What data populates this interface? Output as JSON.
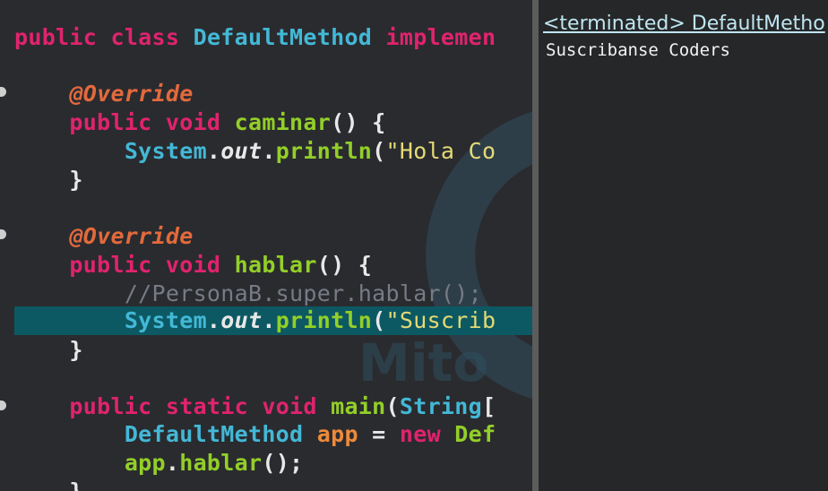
{
  "editor": {
    "lines": [
      {
        "tokens": [
          {
            "t": "public",
            "c": "kw"
          },
          {
            "t": " ",
            "c": "wh"
          },
          {
            "t": "class",
            "c": "kw"
          },
          {
            "t": " ",
            "c": "wh"
          },
          {
            "t": "DefaultMethod",
            "c": "ty"
          },
          {
            "t": " ",
            "c": "wh"
          },
          {
            "t": "implemen",
            "c": "kw"
          }
        ]
      },
      {
        "tokens": [
          {
            "t": "    ",
            "c": "wh"
          },
          {
            "t": "@Override",
            "c": "ann"
          }
        ]
      },
      {
        "tokens": [
          {
            "t": "    ",
            "c": "wh"
          },
          {
            "t": "public",
            "c": "kw"
          },
          {
            "t": " ",
            "c": "wh"
          },
          {
            "t": "void",
            "c": "kw"
          },
          {
            "t": " ",
            "c": "wh"
          },
          {
            "t": "caminar",
            "c": "fn"
          },
          {
            "t": "() {",
            "c": "wh"
          }
        ]
      },
      {
        "tokens": [
          {
            "t": "        ",
            "c": "wh"
          },
          {
            "t": "System",
            "c": "ty"
          },
          {
            "t": ".",
            "c": "wh"
          },
          {
            "t": "out",
            "c": "it"
          },
          {
            "t": ".",
            "c": "wh"
          },
          {
            "t": "println",
            "c": "fn"
          },
          {
            "t": "(",
            "c": "wh"
          },
          {
            "t": "\"Hola Co",
            "c": "st"
          }
        ]
      },
      {
        "tokens": [
          {
            "t": "    }",
            "c": "wh"
          }
        ]
      },
      {
        "tokens": [
          {
            "t": "    ",
            "c": "wh"
          },
          {
            "t": "@Override",
            "c": "ann"
          }
        ]
      },
      {
        "tokens": [
          {
            "t": "    ",
            "c": "wh"
          },
          {
            "t": "public",
            "c": "kw"
          },
          {
            "t": " ",
            "c": "wh"
          },
          {
            "t": "void",
            "c": "kw"
          },
          {
            "t": " ",
            "c": "wh"
          },
          {
            "t": "hablar",
            "c": "fn"
          },
          {
            "t": "() {",
            "c": "wh"
          }
        ]
      },
      {
        "tokens": [
          {
            "t": "        ",
            "c": "wh"
          },
          {
            "t": "//PersonaB.super.hablar();",
            "c": "cm"
          }
        ]
      },
      {
        "tokens": [
          {
            "t": "        ",
            "c": "wh"
          },
          {
            "t": "System",
            "c": "ty"
          },
          {
            "t": ".",
            "c": "wh"
          },
          {
            "t": "out",
            "c": "it"
          },
          {
            "t": ".",
            "c": "wh"
          },
          {
            "t": "println",
            "c": "fn"
          },
          {
            "t": "(",
            "c": "wh"
          },
          {
            "t": "\"Suscrib",
            "c": "st"
          }
        ]
      },
      {
        "tokens": [
          {
            "t": "    }",
            "c": "wh"
          }
        ]
      },
      {
        "tokens": [
          {
            "t": "    ",
            "c": "wh"
          },
          {
            "t": "public",
            "c": "kw"
          },
          {
            "t": " ",
            "c": "wh"
          },
          {
            "t": "static",
            "c": "kw"
          },
          {
            "t": " ",
            "c": "wh"
          },
          {
            "t": "void",
            "c": "kw"
          },
          {
            "t": " ",
            "c": "wh"
          },
          {
            "t": "main",
            "c": "fn"
          },
          {
            "t": "(",
            "c": "wh"
          },
          {
            "t": "String",
            "c": "ty"
          },
          {
            "t": "[",
            "c": "wh"
          }
        ]
      },
      {
        "tokens": [
          {
            "t": "        ",
            "c": "wh"
          },
          {
            "t": "DefaultMethod",
            "c": "ty"
          },
          {
            "t": " ",
            "c": "wh"
          },
          {
            "t": "app",
            "c": "var"
          },
          {
            "t": " = ",
            "c": "wh"
          },
          {
            "t": "new",
            "c": "kw"
          },
          {
            "t": " ",
            "c": "wh"
          },
          {
            "t": "Def",
            "c": "fn"
          }
        ]
      },
      {
        "tokens": [
          {
            "t": "        ",
            "c": "wh"
          },
          {
            "t": "app",
            "c": "fn"
          },
          {
            "t": ".",
            "c": "wh"
          },
          {
            "t": "hablar",
            "c": "fn"
          },
          {
            "t": "();",
            "c": "wh"
          }
        ]
      },
      {
        "tokens": [
          {
            "t": "    }",
            "c": "wh"
          }
        ]
      }
    ]
  },
  "console": {
    "header": "<terminated> DefaultMetho",
    "output": "Suscribanse Coders"
  },
  "colors": {
    "editor_bg": "#2a2b2f",
    "selection_bg": "#0c5963",
    "keyword": "#e0236e",
    "type": "#43b8d6",
    "method": "#93cf28",
    "annotation": "#e36a3c",
    "string": "#e4da74",
    "comment": "#777b85",
    "console_link": "#bfe6f0"
  },
  "icons": [
    "fold-marker-icon",
    "channel-logo-watermark-icon"
  ]
}
